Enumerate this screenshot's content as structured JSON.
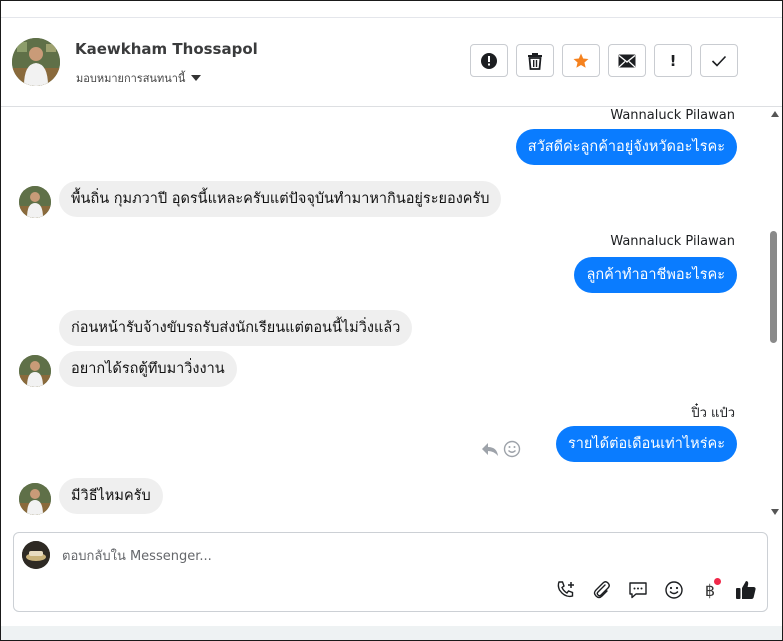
{
  "header": {
    "name": "Kaewkham Thossapol",
    "assign_label": "มอบหมายการสนทนานี้",
    "actions": [
      {
        "icon": "alert-circle-icon"
      },
      {
        "icon": "trash-icon"
      },
      {
        "icon": "star-icon",
        "color": "#f5821f"
      },
      {
        "icon": "mail-icon"
      },
      {
        "icon": "exclamation-icon",
        "label": "!"
      },
      {
        "icon": "check-icon"
      }
    ]
  },
  "messages": [
    {
      "direction": "out",
      "sender": "Wannaluck Pilawan",
      "text": "สวัสดีค่ะลูกค้าอยู่จังหวัดอะไรคะ"
    },
    {
      "direction": "in",
      "text": "พื้นถิ่น กุมภวาปี อุดรนี้แหละครับแต่ปัจจุบันทำมาหากินอยู่ระยองครับ"
    },
    {
      "direction": "out",
      "sender": "Wannaluck Pilawan",
      "text": "ลูกค้าทำอาชีพอะไรคะ"
    },
    {
      "direction": "in",
      "text": "ก่อนหน้ารับจ้างขับรถรับส่งนักเรียนแต่ตอนนี้ไม่วิ่งแล้ว"
    },
    {
      "direction": "in",
      "text": "อยากได้รถตู้ทึบมาวิ่งงาน"
    },
    {
      "direction": "out",
      "sender": "ปิ๋ว แป๋ว",
      "text": "รายได้ต่อเดือนเท่าไหร่คะ"
    },
    {
      "direction": "in",
      "text": "มีวิธีไหมครับ"
    }
  ],
  "composer": {
    "placeholder": "ตอบกลับใน Messenger...",
    "baht_symbol": "฿",
    "tools": [
      "add-call-icon",
      "paperclip-icon",
      "chat-bubble-icon",
      "emoji-icon",
      "baht-icon",
      "thumbs-up-icon"
    ]
  },
  "colors": {
    "outgoing_bubble": "#0a7cff",
    "incoming_bubble": "#efefef",
    "star": "#f5821f",
    "notification_dot": "#f02849"
  }
}
